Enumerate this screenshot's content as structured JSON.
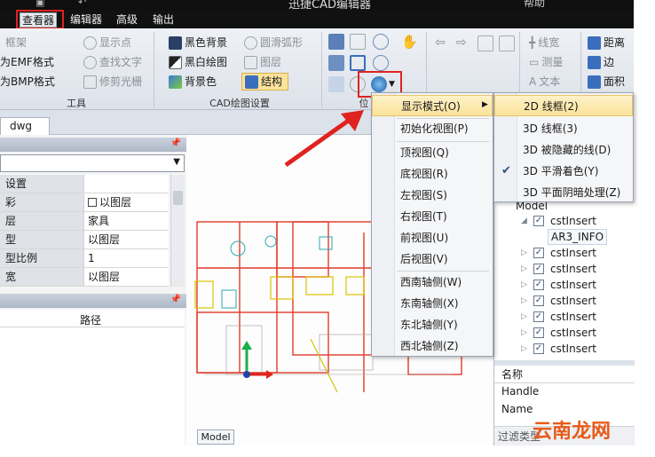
{
  "window": {
    "title": "迅捷CAD编辑器",
    "right_text": "帮助"
  },
  "menu_tabs": [
    "查看器",
    "编辑器",
    "高级",
    "输出"
  ],
  "ribbon": {
    "tools": [
      "框架",
      "为EMF格式",
      "为BMP格式"
    ],
    "show": [
      "显示点",
      "查找文字",
      "修剪光栅"
    ],
    "settings_left": [
      "黑色背景",
      "黑白绘图",
      "背景色"
    ],
    "settings_right": [
      "圆滑弧形",
      "图层",
      "结构"
    ],
    "measure": [
      "线宽",
      "测量",
      "文本"
    ],
    "right": [
      "距离",
      "边",
      "面积"
    ],
    "group_labels": [
      "工具",
      "CAD绘图设置",
      "位"
    ]
  },
  "doc_tab": "dwg",
  "properties": {
    "rows": [
      {
        "k": "设置",
        "v": ""
      },
      {
        "k": "彩",
        "v": "以图层",
        "check": true
      },
      {
        "k": "层",
        "v": "家具"
      },
      {
        "k": "型",
        "v": "以图层"
      },
      {
        "k": "型比例",
        "v": "1"
      },
      {
        "k": "宽",
        "v": "以图层"
      }
    ],
    "lower_header": "路径"
  },
  "model_tab": "Model",
  "tree": {
    "root": "Model",
    "items": [
      "cstInsert",
      "AR3_INFO",
      "cstInsert",
      "cstInsert",
      "cstInsert",
      "cstInsert",
      "cstInsert",
      "cstInsert",
      "cstInsert"
    ]
  },
  "attr": {
    "header": "名称",
    "rows": [
      "Handle",
      "Name"
    ],
    "footer": "过滤类型"
  },
  "context_menu": {
    "items": [
      {
        "label": "显示模式(O)",
        "submenu": true,
        "hl": true
      },
      {
        "label": "初始化视图(P)"
      },
      {
        "label": "顶视图(Q)"
      },
      {
        "label": "底视图(R)"
      },
      {
        "label": "左视图(S)"
      },
      {
        "label": "右视图(T)"
      },
      {
        "label": "前视图(U)"
      },
      {
        "label": "后视图(V)"
      },
      {
        "label": "西南轴侧(W)"
      },
      {
        "label": "东南轴侧(X)"
      },
      {
        "label": "东北轴侧(Y)"
      },
      {
        "label": "西北轴侧(Z)"
      }
    ]
  },
  "submenu": {
    "items": [
      {
        "label": "2D 线框(2)",
        "hl": true
      },
      {
        "label": "3D 线框(3)"
      },
      {
        "label": "3D 被隐藏的线(D)"
      },
      {
        "label": "3D 平滑着色(Y)",
        "checked": true
      },
      {
        "label": "3D 平面阴暗处理(Z)"
      }
    ]
  },
  "watermark": "云南龙网",
  "colors": {
    "highlight": "#fbe39b",
    "red": "#e0231f"
  }
}
